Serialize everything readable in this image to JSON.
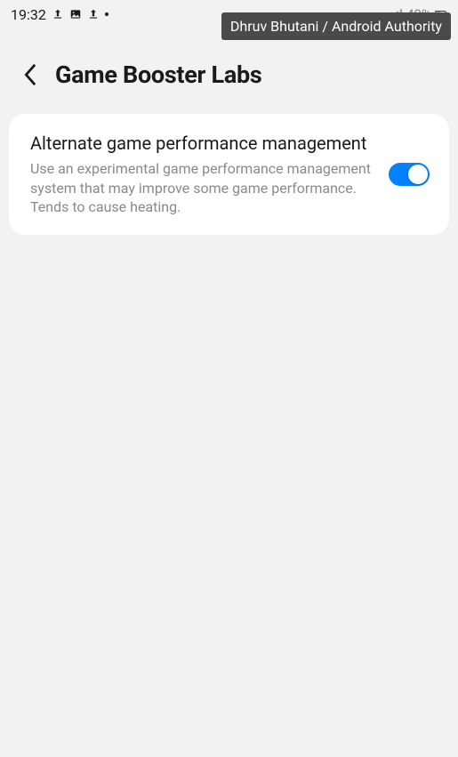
{
  "statusBar": {
    "time": "19:32",
    "batteryPercent": "49%"
  },
  "watermark": {
    "text": "Dhruv Bhutani / Android Authority"
  },
  "header": {
    "title": "Game Booster Labs"
  },
  "settings": {
    "altPerf": {
      "title": "Alternate game performance management",
      "description": "Use an experimental game performance management system that may improve some game performance. Tends to cause heating."
    }
  }
}
